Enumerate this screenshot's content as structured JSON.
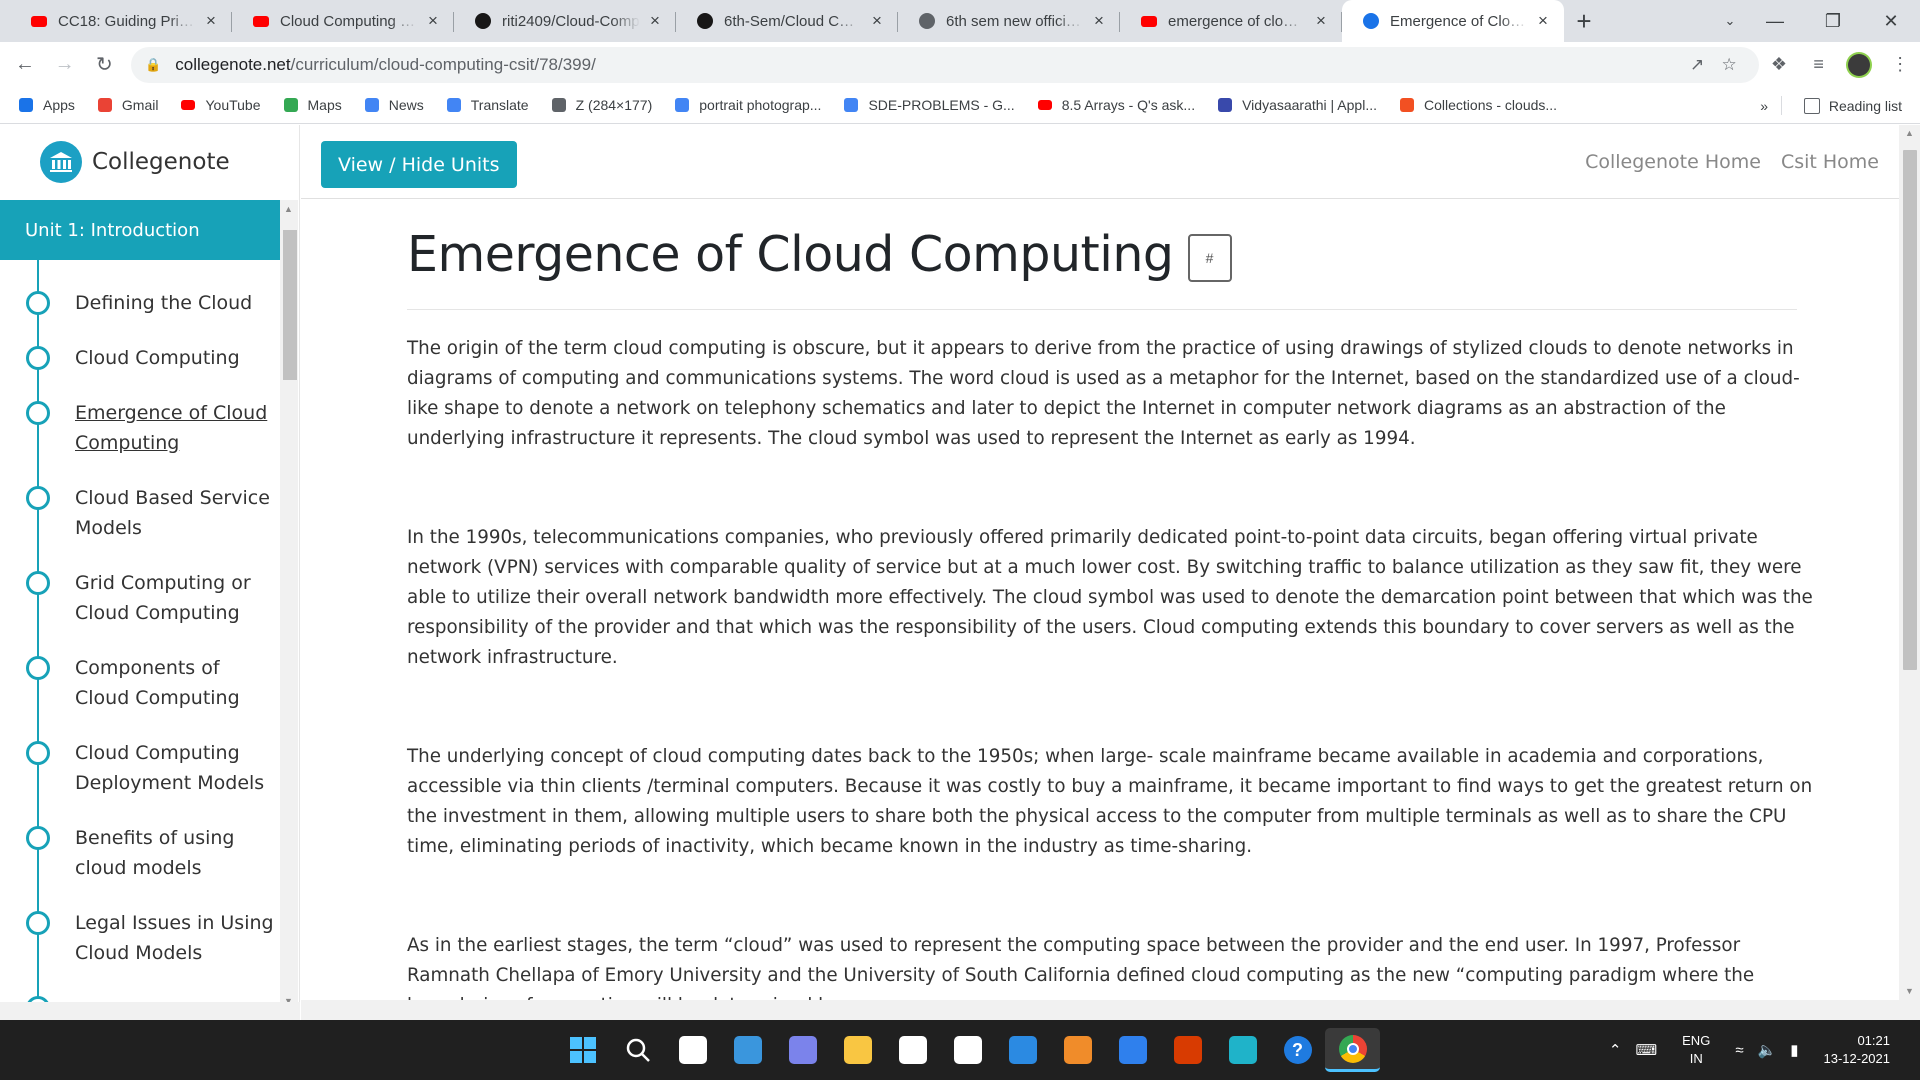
{
  "browser": {
    "tabs": [
      {
        "title": "CC18: Guiding Princip",
        "favicon": "youtube-icon",
        "color": "#ff0000"
      },
      {
        "title": "Cloud Computing - Yo",
        "favicon": "youtube-icon",
        "color": "#ff0000"
      },
      {
        "title": "riti2409/Cloud-Comp",
        "favicon": "github-icon",
        "color": "#181717"
      },
      {
        "title": "6th-Sem/Cloud Comp",
        "favicon": "github-icon",
        "color": "#181717"
      },
      {
        "title": "6th sem new official s",
        "favicon": "globe-icon",
        "color": "#5f6368"
      },
      {
        "title": "emergence of cloud c",
        "favicon": "youtube-icon",
        "color": "#ff0000"
      },
      {
        "title": "Emergence of Cloud C",
        "favicon": "collegenote-icon",
        "color": "#1a73e8",
        "active": true
      }
    ],
    "address": {
      "host": "collegenote.net",
      "path": "/curriculum/cloud-computing-csit/78/399/"
    },
    "bookmarks": [
      {
        "label": "Apps",
        "icon": "apps-grid-icon",
        "color": "#1a73e8"
      },
      {
        "label": "Gmail",
        "icon": "gmail-icon",
        "color": "#ea4335"
      },
      {
        "label": "YouTube",
        "icon": "youtube-icon",
        "color": "#ff0000"
      },
      {
        "label": "Maps",
        "icon": "maps-pin-icon",
        "color": "#34a853"
      },
      {
        "label": "News",
        "icon": "news-icon",
        "color": "#4285f4"
      },
      {
        "label": "Translate",
        "icon": "translate-icon",
        "color": "#4285f4"
      },
      {
        "label": "Z (284×177)",
        "icon": "globe-icon",
        "color": "#5f6368"
      },
      {
        "label": "portrait photograp...",
        "icon": "google-icon",
        "color": "#4285f4"
      },
      {
        "label": "SDE-PROBLEMS - G...",
        "icon": "sheets-doc-icon",
        "color": "#4285f4"
      },
      {
        "label": "8.5 Arrays - Q's ask...",
        "icon": "youtube-icon",
        "color": "#ff0000"
      },
      {
        "label": "Vidyasaarathi | Appl...",
        "icon": "vidyasaarathi-icon",
        "color": "#3949ab"
      },
      {
        "label": "Collections - clouds...",
        "icon": "collections-icon",
        "color": "#f25022"
      }
    ],
    "bookmarks_more": "»",
    "reading_list": "Reading list"
  },
  "site": {
    "brand": "Collegenote",
    "toggle_units": "View / Hide Units",
    "nav_links": [
      "Collegenote Home",
      "Csit Home"
    ],
    "unit_title": "Unit 1: Introduction",
    "toc": [
      {
        "label": "Defining the Cloud"
      },
      {
        "label": "Cloud Computing"
      },
      {
        "label": "Emergence of Cloud Computing",
        "current": true
      },
      {
        "label": "Cloud Based Service Models"
      },
      {
        "label": "Grid Computing or Cloud Computing"
      },
      {
        "label": "Components of Cloud Computing"
      },
      {
        "label": "Cloud Computing Deployment Models"
      },
      {
        "label": "Benefits of using cloud models"
      },
      {
        "label": "Legal Issues in Using Cloud Models"
      }
    ]
  },
  "article": {
    "title": "Emergence of Cloud Computing",
    "anchor": "#",
    "paragraphs": [
      "The origin of the term cloud computing is obscure, but it appears to derive from the practice of using drawings of stylized clouds to denote networks in diagrams of computing and communications systems. The word cloud is used as a metaphor for the Internet, based on the standardized use of a cloud-like shape to denote a network on telephony schematics and later to depict the Internet in computer network diagrams as an abstraction of the underlying infrastructure it represents. The cloud symbol was used to represent the Internet as early as 1994.",
      "In the 1990s, telecommunications companies, who previously offered primarily dedicated point-to-point data circuits, began offering virtual private network (VPN) services with comparable quality of service but at a much lower cost. By switching traffic to balance utilization as they saw fit, they were able to utilize their overall network bandwidth more effectively. The cloud symbol was used to denote the demarcation point between that which was the responsibility of the provider and that which was the responsibility of the users. Cloud computing extends this boundary to cover servers as well as the network infrastructure.",
      "The underlying concept of cloud computing dates back to the 1950s; when large-  scale mainframe became available in academia and corporations, accessible via thin clients /terminal computers. Because it was costly to buy a mainframe, it became important to find ways to get the greatest return on the investment in them, allowing multiple users to share both the physical access to the computer from multiple terminals as well as to share the CPU time, eliminating periods of inactivity, which became known in the industry as time-sharing.",
      "As in the earliest stages, the term “cloud” was used to represent the computing space between the provider and the end user. In 1997, Professor Ramnath Chellapa of Emory University and the University of South California defined cloud computing as the new “computing paradigm where the boundaries of computing will be determined by"
    ]
  },
  "taskbar": {
    "apps": [
      {
        "icon": "windows-start-icon",
        "color": "#4cc2ff"
      },
      {
        "icon": "search-icon",
        "color": "#ffffff"
      },
      {
        "icon": "task-view-icon",
        "color": "#ffffff"
      },
      {
        "icon": "widgets-icon",
        "color": "#3a96dd"
      },
      {
        "icon": "teams-chat-icon",
        "color": "#7b83eb"
      },
      {
        "icon": "file-explorer-icon",
        "color": "#f9c642"
      },
      {
        "icon": "ms-store-icon",
        "color": "#ffffff"
      },
      {
        "icon": "dropbox-icon",
        "color": "#ffffff"
      },
      {
        "icon": "mail-icon",
        "color": "#2b8ae2"
      },
      {
        "icon": "sublime-text-icon",
        "color": "#f08c2a"
      },
      {
        "icon": "vscode-icon",
        "color": "#2f80ed"
      },
      {
        "icon": "office-icon",
        "color": "#d83b01"
      },
      {
        "icon": "edge-icon",
        "color": "#1fb3c9"
      },
      {
        "icon": "help-icon",
        "color": "#1f7be0"
      },
      {
        "icon": "chrome-icon",
        "color": "#4285f4"
      }
    ],
    "lang_top": "ENG",
    "lang_bottom": "IN",
    "time": "01:21",
    "date": "13-12-2021"
  }
}
